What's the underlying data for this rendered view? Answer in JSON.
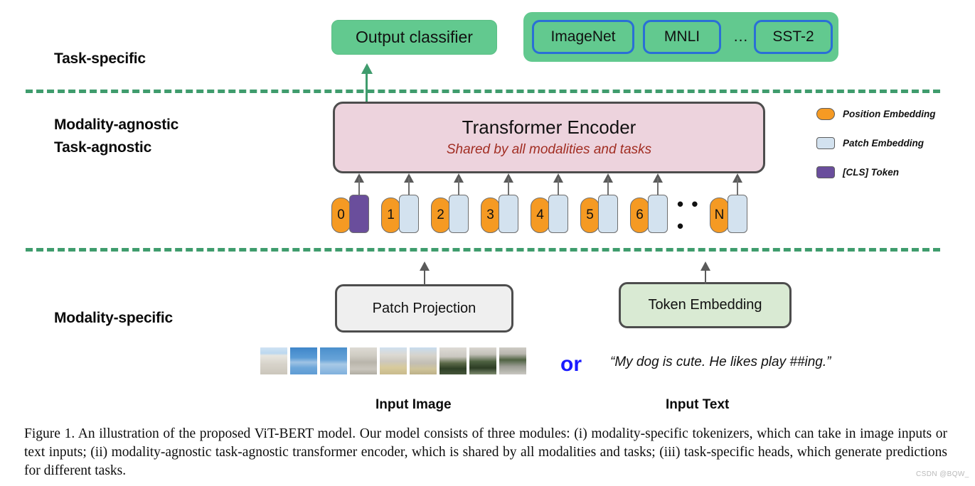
{
  "rows": {
    "task_specific": "Task-specific",
    "modality_agnostic": "Modality-agnostic",
    "task_agnostic": "Task-agnostic",
    "modality_specific": "Modality-specific"
  },
  "task_specific": {
    "output_classifier": "Output classifier",
    "tasks": [
      "ImageNet",
      "MNLI",
      "SST-2"
    ],
    "task_ellipsis": "..."
  },
  "encoder": {
    "title": "Transformer Encoder",
    "subtitle": "Shared by all modalities and tasks"
  },
  "tokens": {
    "positions": [
      "0",
      "1",
      "2",
      "3",
      "4",
      "5",
      "6",
      "N"
    ],
    "ellipsis": "• • •",
    "cls_label": "[CLS]"
  },
  "legend": [
    {
      "name": "Position Embedding",
      "color": "#f59a23"
    },
    {
      "name": "Patch Embedding",
      "color": "#d3e2ef"
    },
    {
      "name": "[CLS] Token",
      "color": "#6a4e9c"
    }
  ],
  "modality_specific": {
    "patch_projection": "Patch Projection",
    "token_embedding": "Token Embedding",
    "or": "or",
    "sample_text": "“My dog is cute. He likes play ##ing.”",
    "input_image_label": "Input Image",
    "input_text_label": "Input Text",
    "patch_count": 9
  },
  "colors": {
    "green_accent": "#3f9c6d",
    "green_box": "#62c98f",
    "chip_border": "#2a6fd6",
    "encoder_fill": "#edd3dd",
    "encoder_border": "#4d4d4d",
    "subtitle_red": "#a12d22",
    "or_blue": "#1a1aff",
    "position_orange": "#f59a23",
    "patch_blue": "#d3e2ef",
    "cls_purple": "#6a4e9c"
  },
  "caption": {
    "text": "Figure 1. An illustration of the proposed ViT-BERT model. Our model consists of three modules: (i) modality-specific tokenizers, which can take in image inputs or text inputs; (ii) modality-agnostic task-agnostic transformer encoder, which is shared by all modalities and tasks; (iii) task-specific heads, which generate predictions for different tasks."
  },
  "watermark": "CSDN @BQW_"
}
